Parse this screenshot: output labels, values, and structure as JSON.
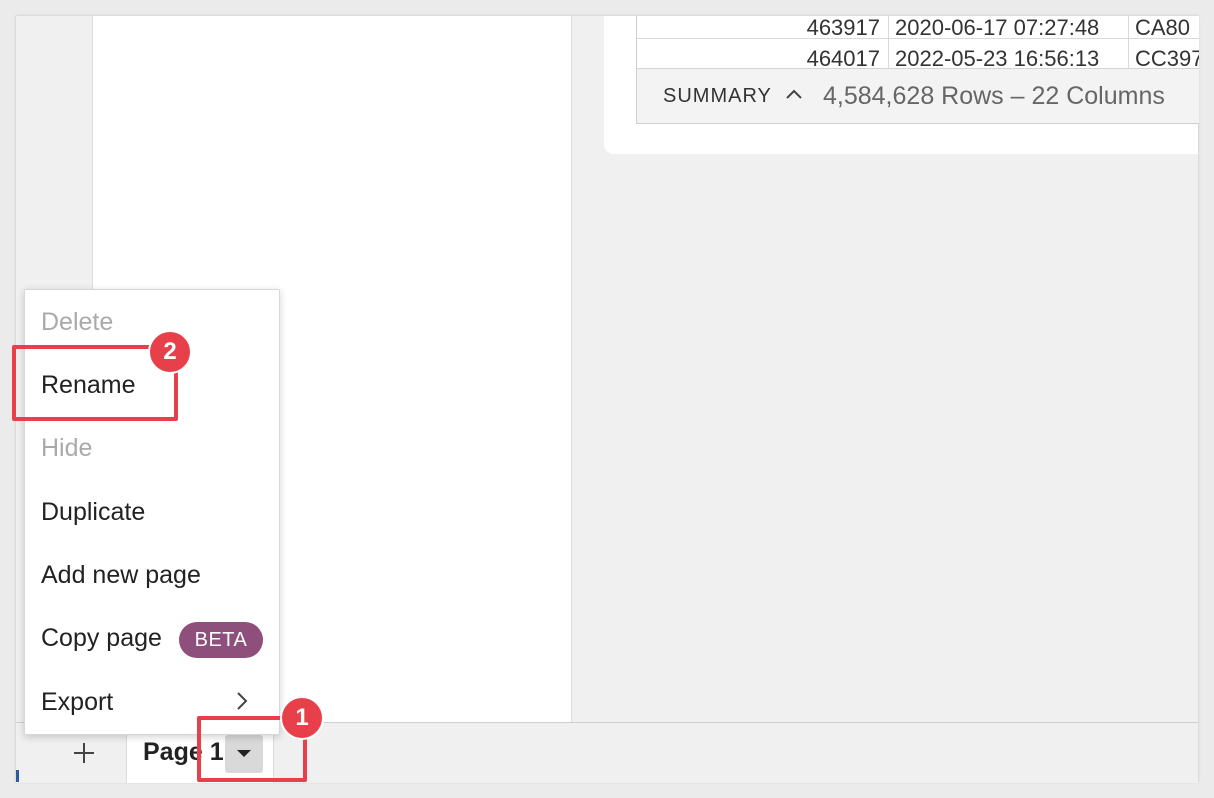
{
  "table": {
    "rows": [
      [
        "463917",
        "2020-06-17 07:27:48",
        "CA80"
      ],
      [
        "464017",
        "2022-05-23 16:56:13",
        "CC397"
      ]
    ]
  },
  "summary": {
    "label": "SUMMARY",
    "chevron": "^",
    "count": "4,584,628 Rows – 22 Columns"
  },
  "bottom_bar": {
    "add_icon": "+",
    "page_tab_label": "Page 1"
  },
  "context_menu": {
    "items": [
      {
        "label": "Delete",
        "disabled": true
      },
      {
        "label": "Rename",
        "disabled": false
      },
      {
        "label": "Hide",
        "disabled": true
      },
      {
        "label": "Duplicate",
        "disabled": false
      },
      {
        "label": "Add new page",
        "disabled": false
      },
      {
        "label": "Copy page",
        "disabled": false,
        "badge": "BETA"
      },
      {
        "label": "Export",
        "disabled": false,
        "submenu": true
      }
    ]
  },
  "annotations": {
    "step1": "1",
    "step2": "2"
  },
  "colors": {
    "highlight": "#e8404a",
    "beta_badge": "#8e4f7c",
    "disabled_text": "#aaaaaa"
  },
  "icons": {
    "add": "plus-icon",
    "caret": "caret-down-icon",
    "chevron": "chevron-up-icon",
    "submenu": "chevron-right-icon"
  }
}
